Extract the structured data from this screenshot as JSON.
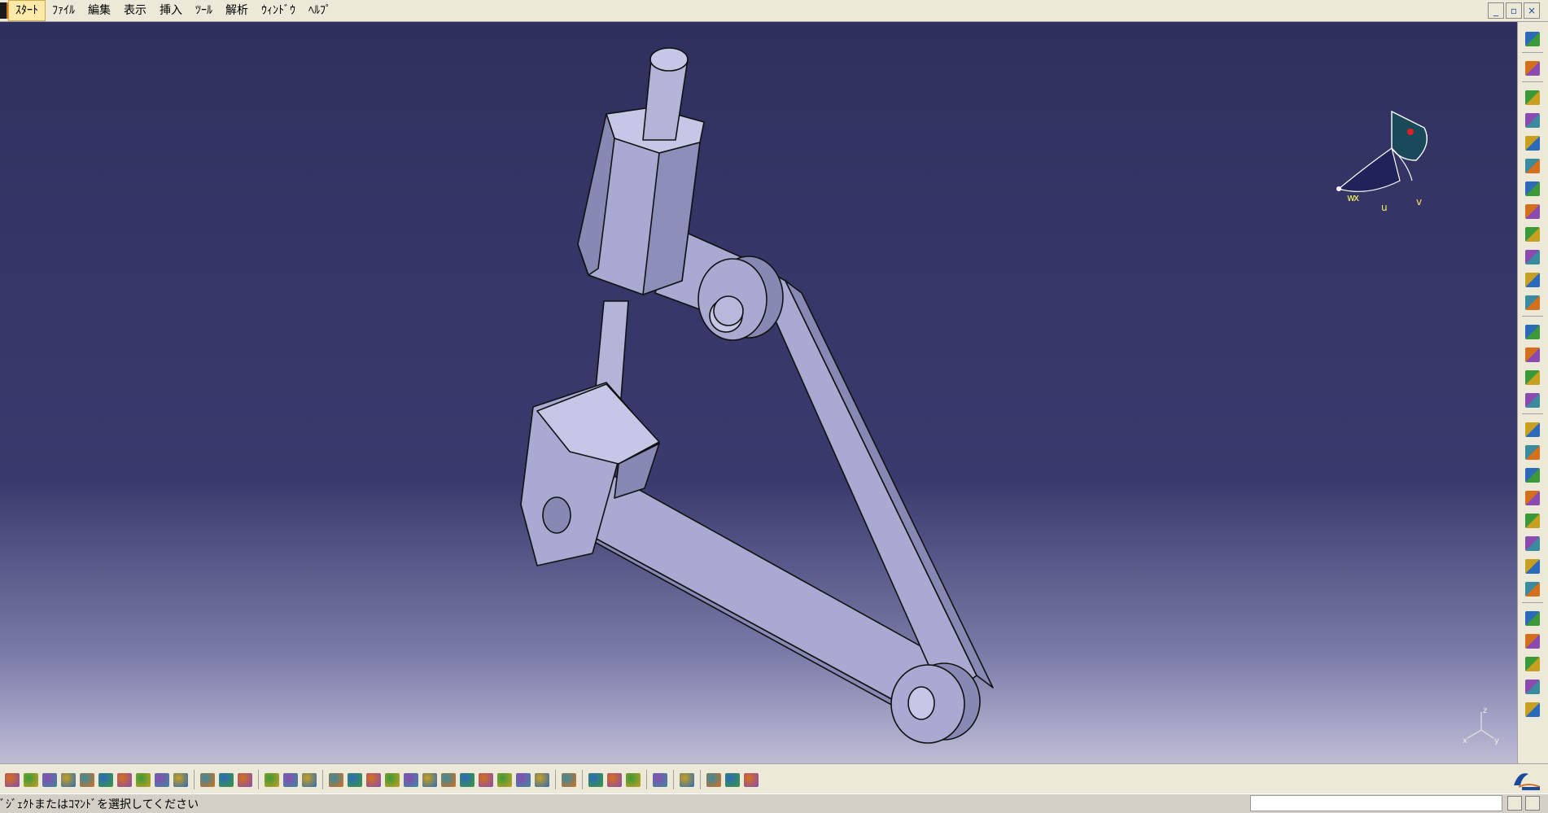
{
  "menubar": {
    "items": [
      {
        "label": "ｽﾀｰﾄ",
        "active": true
      },
      {
        "label": "ﾌｧｲﾙ"
      },
      {
        "label": "編集"
      },
      {
        "label": "表示"
      },
      {
        "label": "挿入"
      },
      {
        "label": "ﾂｰﾙ"
      },
      {
        "label": "解析"
      },
      {
        "label": "ｳｨﾝﾄﾞｳ"
      },
      {
        "label": "ﾍﾙﾌﾟ"
      }
    ],
    "window_controls": {
      "minimize": "_",
      "restore": "▫",
      "close": "×"
    }
  },
  "compass": {
    "label_w": "w",
    "label_u": "u",
    "label_v": "v",
    "label_x": "x"
  },
  "axis_triad": {
    "x": "x",
    "y": "y",
    "z": "z"
  },
  "status": {
    "message": "ﾞｼﾞｪｸﾄまたはｺﾏﾝﾄﾞを選択してください",
    "input_value": ""
  },
  "colors": {
    "part_face": "#a9a9d2",
    "part_dark": "#8888b4",
    "part_light": "#c6c6e6",
    "edge": "#111111",
    "accent": "#d4701c"
  },
  "toolbar_right_icons": [
    "catalog-icon",
    "select-arrow-icon",
    "sketch-icon",
    "product-icon",
    "component-icon",
    "part-icon",
    "existing-component-icon",
    "replace-icon",
    "graph-tree-icon",
    "reorder-icon",
    "multi-instantiate-icon",
    "fast-instantiate-icon",
    "explode-icon",
    "manipulate-icon",
    "snap-icon",
    "smart-move-icon",
    "clash-icon",
    "coincidence-constraint-icon",
    "contact-constraint-icon",
    "offset-constraint-icon",
    "angle-constraint-icon",
    "fix-constraint-icon",
    "fix-together-icon",
    "quick-constraint-icon",
    "flexible-icon",
    "change-constraint-icon",
    "reuse-pattern-icon",
    "update-icon",
    "measure-icon"
  ],
  "toolbar_bottom_icons": [
    "new-icon",
    "open-icon",
    "save-icon",
    "print-icon",
    "cut-icon",
    "copy-icon",
    "paste-icon",
    "undo-icon",
    "redo-icon",
    "whats-this-icon",
    "formula-icon",
    "knowledge-icon",
    "sun-icon",
    "table-icon",
    "lock-icon",
    "dimension-icon",
    "fly-mode-icon",
    "fit-all-icon",
    "pan-icon",
    "rotate-icon",
    "zoom-in-icon",
    "zoom-out-icon",
    "normal-view-icon",
    "iso-view-icon",
    "shading-icon",
    "hide-show-icon",
    "swap-visible-icon",
    "normal-icon",
    "section-icon",
    "measure-between-icon",
    "measure-item-icon",
    "mass-icon",
    "spiral-icon",
    "scene-icon",
    "render-icon",
    "material-icon",
    "grid-icon"
  ]
}
